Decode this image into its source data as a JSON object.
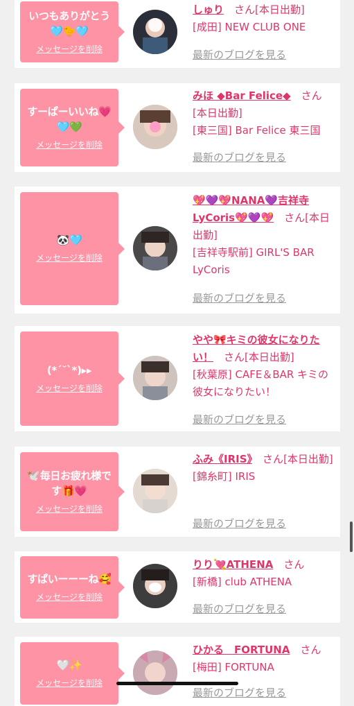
{
  "messages": [
    {
      "text": "いつもありがとう🩵🐤🩵",
      "delete_label": "メッセージを削除",
      "name": "しゅり",
      "san": "さん",
      "status": "[本日出勤]",
      "shop": "[成田] NEW CLUB ONE",
      "blog_label": "最新のブログを見る"
    },
    {
      "text": "すーぱーいいね💗🩵💚",
      "delete_label": "メッセージを削除",
      "name": "みほ ◆Bar Felice◆",
      "san": "さん",
      "status": "[本日出勤]",
      "shop": "[東三国] Bar Felice 東三国",
      "blog_label": "最新のブログを見る"
    },
    {
      "text": "🐼🩵",
      "delete_label": "メッセージを削除",
      "name": "💖💜💖NANA💜吉祥寺LyCoris💖💜💖",
      "san": "さん",
      "status": "[本日出勤]",
      "shop": "[吉祥寺駅前] GIRL'S BAR LyCoris",
      "blog_label": "最新のブログを見る"
    },
    {
      "text": "(*ˊ˘ˋ*)▸▸",
      "delete_label": "メッセージを削除",
      "name": "やや🎀キミの彼女になりたい！",
      "san": "さん",
      "status": "[本日出勤]",
      "shop": "[秋葉原] CAFE＆BAR キミの彼女になりたい！",
      "blog_label": "最新のブログを見る"
    },
    {
      "text": "🕊️毎日お疲れ様です🎁💗",
      "delete_label": "メッセージを削除",
      "name": "ふみ《IRIS》",
      "san": "さん",
      "status": "[本日出勤]",
      "shop": "[錦糸町] IRIS",
      "blog_label": "最新のブログを見る"
    },
    {
      "text": "すぱいーーーね🥰",
      "delete_label": "メッセージを削除",
      "name": "りり💘ATHENA",
      "san": "さん",
      "status": "",
      "shop": "[新橋] club ATHENA",
      "blog_label": "最新のブログを見る"
    },
    {
      "text": "🤍✨",
      "delete_label": "メッセージを削除",
      "name": "ひかる　FORTUNA",
      "san": "さん",
      "status": "",
      "shop": "[梅田] FORTUNA",
      "blog_label": "最新のブログを見る"
    }
  ],
  "colors": {
    "bubble": "#ff93a6",
    "accent": "#e0356b",
    "muted": "#999999",
    "background": "#f0f0f0"
  }
}
